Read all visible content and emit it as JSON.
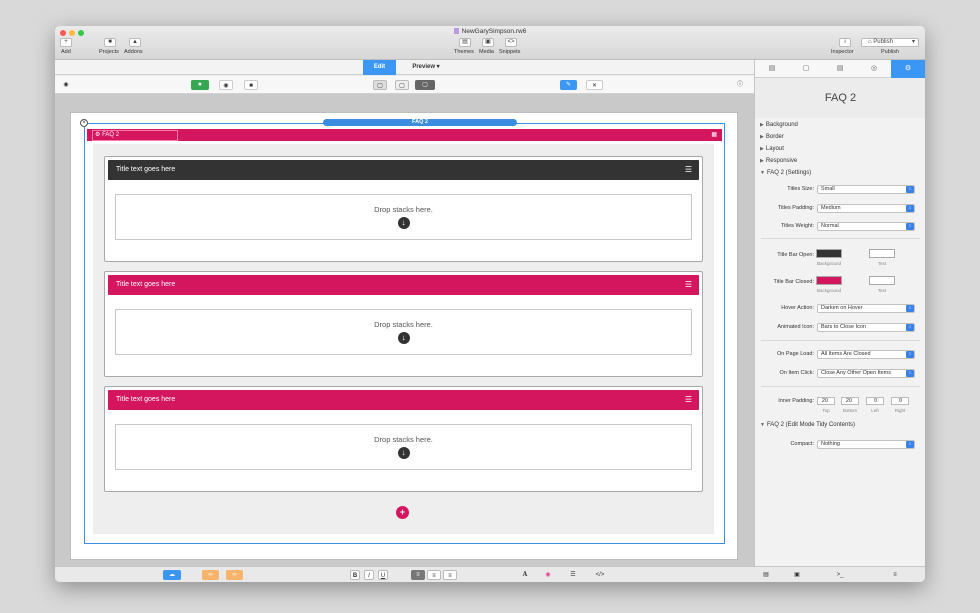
{
  "window": {
    "doc_title": "NewGarySimpson.rw6",
    "toolbar": {
      "add": "Add",
      "projects": "Projects",
      "addons": "Addons",
      "themes": "Themes",
      "media": "Media",
      "snippets": "Snippets",
      "inspector": "Inspector",
      "publish_button": "Publish",
      "publish": "Publish"
    }
  },
  "tabs": {
    "edit": "Edit",
    "preview": "Preview"
  },
  "canvas": {
    "stack_name": "FAQ 2",
    "stack_bar_label": "FAQ 2",
    "items": [
      {
        "title": "Title text goes here",
        "drop": "Drop stacks here.",
        "color": "#333333"
      },
      {
        "title": "Title text goes here",
        "drop": "Drop stacks here.",
        "color": "#d4165f"
      },
      {
        "title": "Title text goes here",
        "drop": "Drop stacks here.",
        "color": "#d4165f"
      }
    ]
  },
  "inspector": {
    "header": "FAQ 2",
    "sections": [
      "Background",
      "Border",
      "Layout",
      "Responsive",
      "FAQ 2 (Settings)"
    ],
    "titles_size_label": "Titles Size:",
    "titles_size": "Small",
    "titles_padding_label": "Titles Padding:",
    "titles_padding": "Medium",
    "titles_weight_label": "Titles Weight:",
    "titles_weight": "Normal",
    "bar_open_label": "Title Bar Open:",
    "bar_closed_label": "Title Bar Closed:",
    "cap_background": "Background",
    "cap_text": "Text",
    "hover_action_label": "Hover Action:",
    "hover_action": "Darken on Hover",
    "animated_icon_label": "Animated Icon:",
    "animated_icon": "Bars to Close Icon",
    "on_page_load_label": "On Page Load:",
    "on_page_load": "All Items Are Closed",
    "on_item_click_label": "On Item Click:",
    "on_item_click": "Close Any Other Open Items",
    "inner_padding_label": "Inner Padding:",
    "padding": [
      {
        "value": "20",
        "cap": "Top"
      },
      {
        "value": "20",
        "cap": "Bottom"
      },
      {
        "value": "0",
        "cap": "Left"
      },
      {
        "value": "0",
        "cap": "Right"
      }
    ],
    "tidy_section": "FAQ 2 (Edit Mode Tidy Contents)",
    "compact_label": "Compact:",
    "compact": "Nothing"
  },
  "colors": {
    "accent": "#3b97f3",
    "brand": "#d4165f",
    "dark_bar": "#333333",
    "selection": "#3b8de0"
  }
}
